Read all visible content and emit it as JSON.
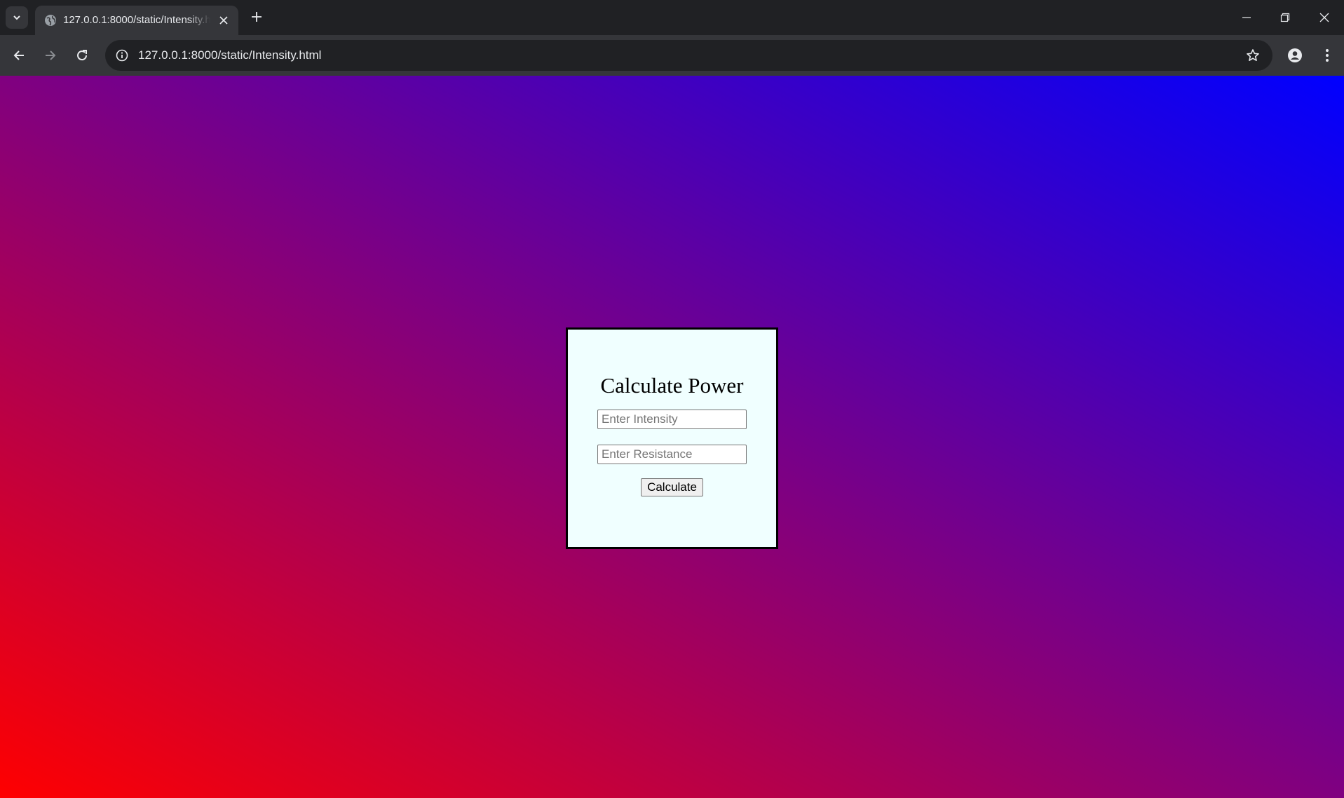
{
  "browser": {
    "tab": {
      "title": "127.0.0.1:8000/static/Intensity.html",
      "favicon": "globe-icon"
    },
    "omnibox": {
      "url": "127.0.0.1:8000/static/Intensity.html"
    },
    "icons": {
      "tab_list": "chevron-down-icon",
      "tab_close": "close-icon",
      "new_tab": "plus-icon",
      "back": "arrow-left-icon",
      "forward": "arrow-right-icon",
      "reload": "reload-icon",
      "site_info": "info-icon",
      "bookmark": "star-icon",
      "profile": "person-icon",
      "menu": "kebab-menu-icon",
      "minimize": "minimize-icon",
      "restore": "restore-icon",
      "close_window": "close-icon"
    },
    "colors": {
      "tabstrip": "#202124",
      "toolbar": "#35363a",
      "text": "#e8eaed"
    }
  },
  "page": {
    "background_gradient": [
      "#ff0000",
      "#800080",
      "#0000ff"
    ],
    "card_background": "#f0ffff",
    "heading": "Calculate Power",
    "intensity_placeholder": "Enter Intensity",
    "intensity_value": "",
    "resistance_placeholder": "Enter Resistance",
    "resistance_value": "",
    "button_label": "Calculate"
  }
}
